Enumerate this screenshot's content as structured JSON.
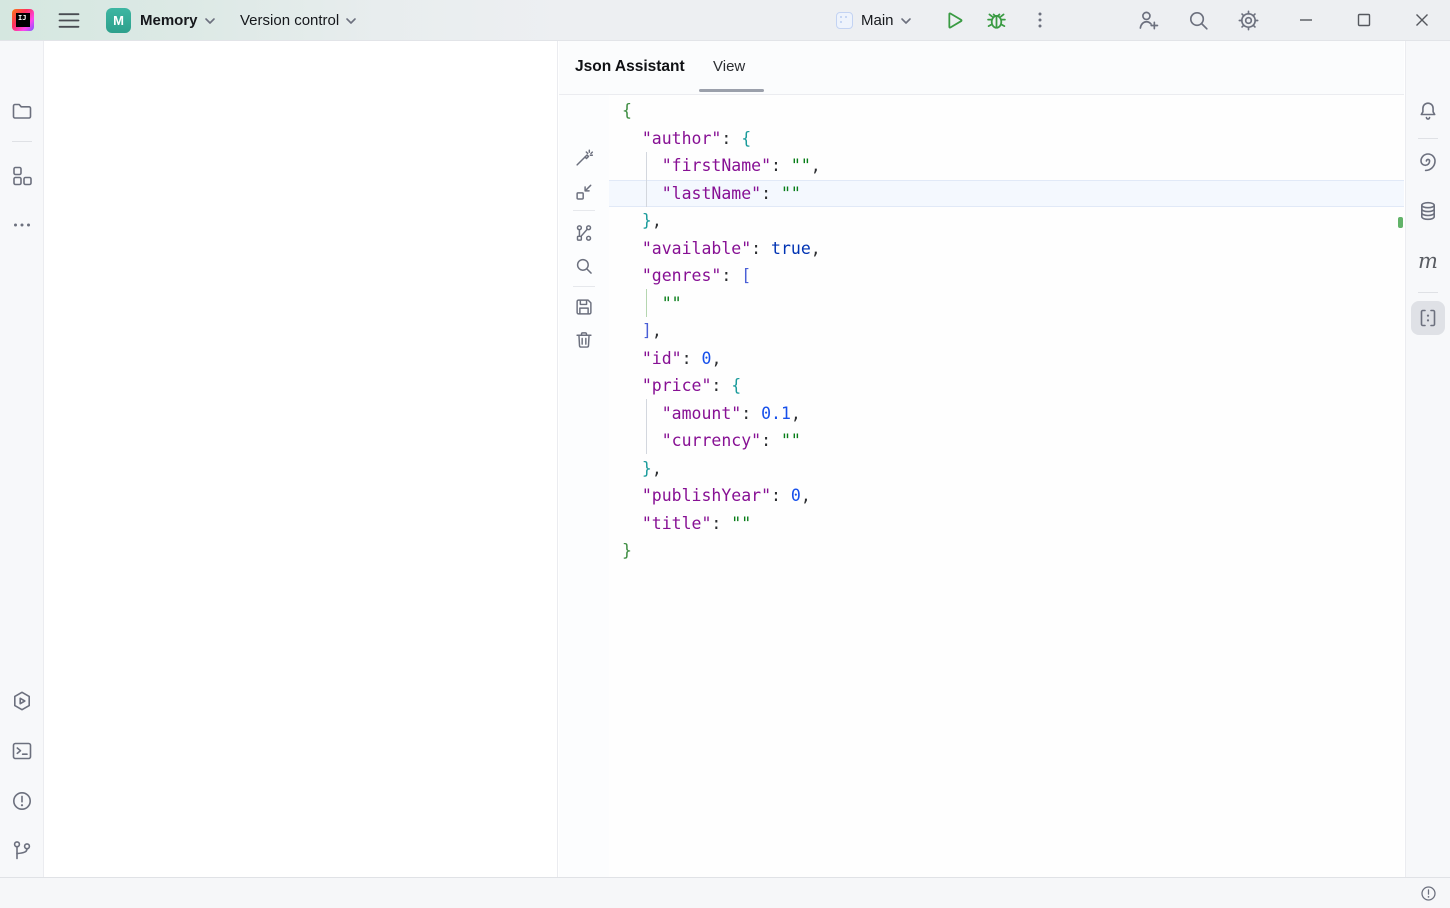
{
  "titlebar": {
    "project_badge": "M",
    "project_name": "Memory",
    "vcs_widget_label": "Version control",
    "run_config_label": "Main",
    "logo_text": "IJ"
  },
  "panel": {
    "title": "Json Assistant",
    "active_tab": "View"
  },
  "theme": {
    "accent_blue": "#3574f0",
    "run_green": "#3a9b43",
    "icon_gray": "#6c707e",
    "selected_stripe_bg": "#dfe1e6",
    "caret_line_bg": "#f4f8fe"
  },
  "right_stripe": {
    "maven_label": "m"
  },
  "editor": {
    "caret_line": 4,
    "token_colors": {
      "key": "#871094",
      "str": "#067d17",
      "num": "#1750eb",
      "kw": "#0033b3",
      "b1": "#3c8c40",
      "b2": "#1a9b9b",
      "br": "#4a5fd6",
      "p": "#2b2d30"
    },
    "lines": [
      {
        "indent": 0,
        "seg": [
          {
            "t": "{",
            "c": "b1"
          }
        ]
      },
      {
        "indent": 1,
        "seg": [
          {
            "t": "\"author\"",
            "c": "key"
          },
          {
            "t": ": ",
            "c": "p"
          },
          {
            "t": "{",
            "c": "b2"
          }
        ]
      },
      {
        "indent": 2,
        "seg": [
          {
            "t": "\"firstName\"",
            "c": "key"
          },
          {
            "t": ": ",
            "c": "p"
          },
          {
            "t": "\"\"",
            "c": "str"
          },
          {
            "t": ",",
            "c": "p"
          }
        ]
      },
      {
        "indent": 2,
        "seg": [
          {
            "t": "\"lastName\"",
            "c": "key"
          },
          {
            "t": ": ",
            "c": "p"
          },
          {
            "t": "\"\"",
            "c": "str"
          }
        ]
      },
      {
        "indent": 1,
        "seg": [
          {
            "t": "}",
            "c": "b2"
          },
          {
            "t": ",",
            "c": "p"
          }
        ]
      },
      {
        "indent": 1,
        "seg": [
          {
            "t": "\"available\"",
            "c": "key"
          },
          {
            "t": ": ",
            "c": "p"
          },
          {
            "t": "true",
            "c": "kw"
          },
          {
            "t": ",",
            "c": "p"
          }
        ]
      },
      {
        "indent": 1,
        "seg": [
          {
            "t": "\"genres\"",
            "c": "key"
          },
          {
            "t": ": ",
            "c": "p"
          },
          {
            "t": "[",
            "c": "br"
          }
        ]
      },
      {
        "indent": 2,
        "seg": [
          {
            "t": "\"\"",
            "c": "str"
          }
        ]
      },
      {
        "indent": 1,
        "seg": [
          {
            "t": "]",
            "c": "br"
          },
          {
            "t": ",",
            "c": "p"
          }
        ]
      },
      {
        "indent": 1,
        "seg": [
          {
            "t": "\"id\"",
            "c": "key"
          },
          {
            "t": ": ",
            "c": "p"
          },
          {
            "t": "0",
            "c": "num"
          },
          {
            "t": ",",
            "c": "p"
          }
        ]
      },
      {
        "indent": 1,
        "seg": [
          {
            "t": "\"price\"",
            "c": "key"
          },
          {
            "t": ": ",
            "c": "p"
          },
          {
            "t": "{",
            "c": "b2"
          }
        ]
      },
      {
        "indent": 2,
        "seg": [
          {
            "t": "\"amount\"",
            "c": "key"
          },
          {
            "t": ": ",
            "c": "p"
          },
          {
            "t": "0.1",
            "c": "num"
          },
          {
            "t": ",",
            "c": "p"
          }
        ]
      },
      {
        "indent": 2,
        "seg": [
          {
            "t": "\"currency\"",
            "c": "key"
          },
          {
            "t": ": ",
            "c": "p"
          },
          {
            "t": "\"\"",
            "c": "str"
          }
        ]
      },
      {
        "indent": 1,
        "seg": [
          {
            "t": "}",
            "c": "b2"
          },
          {
            "t": ",",
            "c": "p"
          }
        ]
      },
      {
        "indent": 1,
        "seg": [
          {
            "t": "\"publishYear\"",
            "c": "key"
          },
          {
            "t": ": ",
            "c": "p"
          },
          {
            "t": "0",
            "c": "num"
          },
          {
            "t": ",",
            "c": "p"
          }
        ]
      },
      {
        "indent": 1,
        "seg": [
          {
            "t": "\"title\"",
            "c": "key"
          },
          {
            "t": ": ",
            "c": "p"
          },
          {
            "t": "\"\"",
            "c": "str"
          }
        ]
      },
      {
        "indent": 0,
        "seg": [
          {
            "t": "}",
            "c": "b1"
          }
        ]
      }
    ]
  }
}
